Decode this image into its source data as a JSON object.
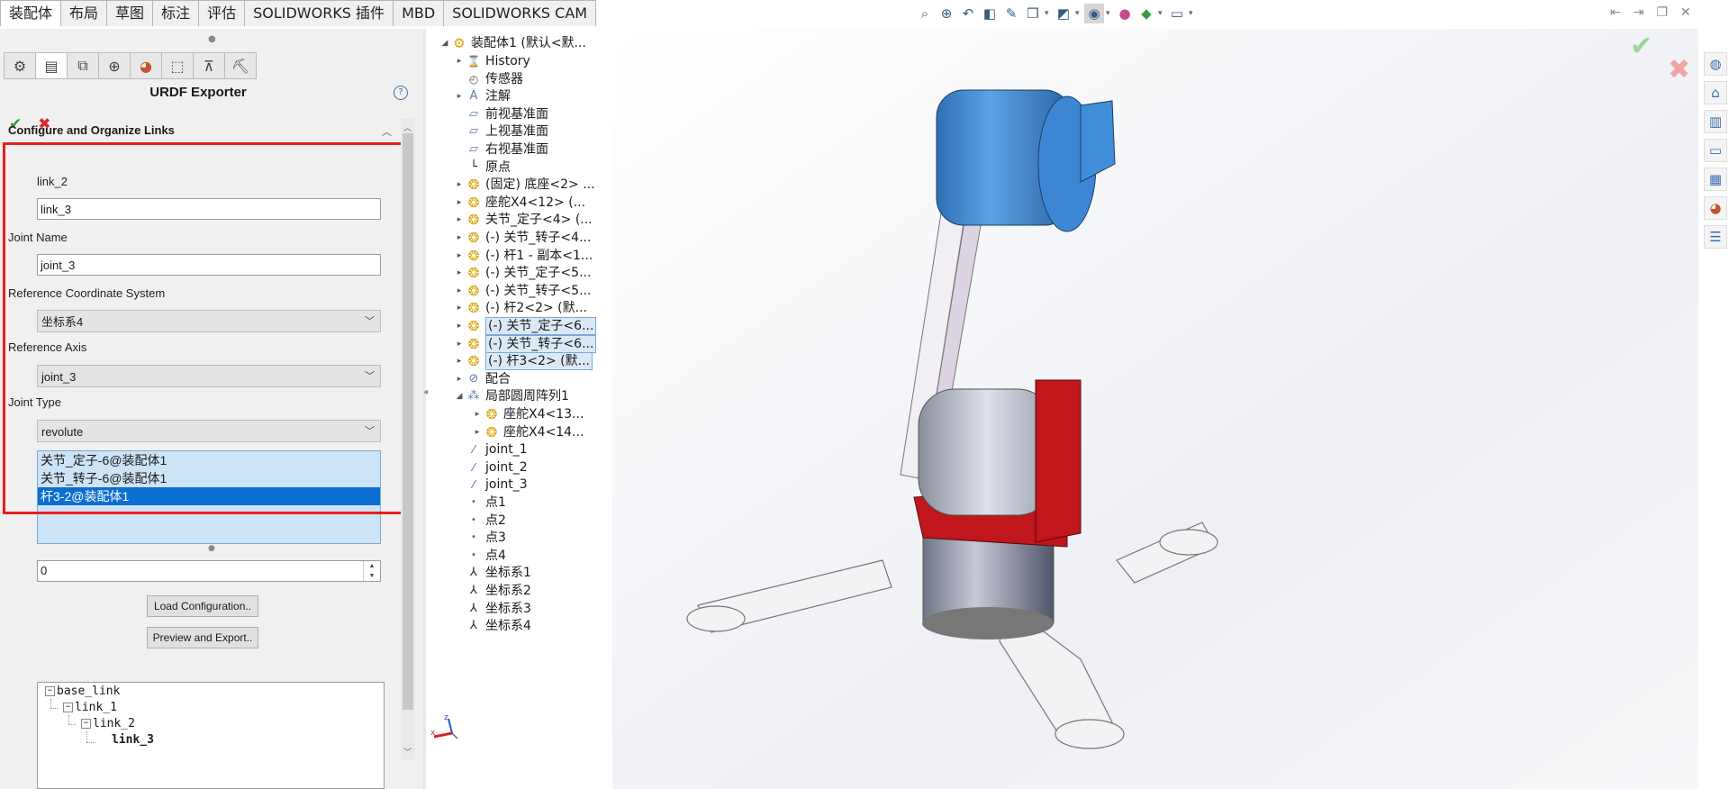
{
  "ribbon": {
    "tabs": [
      "装配体",
      "布局",
      "草图",
      "标注",
      "评估",
      "SOLIDWORKS 插件",
      "MBD",
      "SOLIDWORKS CAM"
    ],
    "active_tab": "装配体",
    "view_icons": [
      "zoom-to-fit-icon",
      "zoom-area-icon",
      "previous-view-icon",
      "section-view-icon",
      "dynamic-annotation-icon",
      "view-orientation-icon",
      "display-style-icon",
      "hide-show-icon",
      "edit-appearance-icon",
      "apply-scene-icon",
      "view-settings-icon"
    ]
  },
  "property_manager": {
    "title": "URDF Exporter",
    "help": "?",
    "ok_glyph": "✔",
    "cancel_glyph": "✖",
    "group_title": "Configure and Organize Links",
    "parent_link": "link_2",
    "link_name_value": "link_3",
    "joint_name_label": "Joint Name",
    "joint_name_value": "joint_3",
    "ref_coord_label": "Reference Coordinate System",
    "ref_coord_value": "坐标系4",
    "ref_axis_label": "Reference Axis",
    "ref_axis_value": "joint_3",
    "joint_type_label": "Joint Type",
    "joint_type_value": "revolute",
    "components": [
      "关节_定子-6@装配体1",
      "关节_转子-6@装配体1",
      "杆3-2@装配体1"
    ],
    "selected_component_index": 2,
    "number_value": "0",
    "load_button": "Load Configuration..",
    "preview_button": "Preview and Export..",
    "tree": {
      "root": "base_link",
      "l1": "link_1",
      "l2": "link_2",
      "l3": "link_3"
    }
  },
  "feature_tree": {
    "root": "装配体1  (默认<默...",
    "items": [
      {
        "label": "History",
        "icon": "history-icon"
      },
      {
        "label": "传感器",
        "icon": "sensor-icon"
      },
      {
        "label": "注解",
        "icon": "annotation-icon"
      },
      {
        "label": "前视基准面",
        "icon": "plane-icon"
      },
      {
        "label": "上视基准面",
        "icon": "plane-icon"
      },
      {
        "label": "右视基准面",
        "icon": "plane-icon"
      },
      {
        "label": "原点",
        "icon": "origin-icon"
      },
      {
        "label": "(固定) 底座<2> ...",
        "icon": "component-icon"
      },
      {
        "label": "座舵X4<12> (...",
        "icon": "component-icon"
      },
      {
        "label": "关节_定子<4> (...",
        "icon": "component-icon"
      },
      {
        "label": "(-) 关节_转子<4...",
        "icon": "component-icon"
      },
      {
        "label": "(-) 杆1 - 副本<1...",
        "icon": "component-icon"
      },
      {
        "label": "(-) 关节_定子<5...",
        "icon": "component-icon"
      },
      {
        "label": "(-) 关节_转子<5...",
        "icon": "component-icon"
      },
      {
        "label": "(-) 杆2<2> (默...",
        "icon": "component-icon"
      },
      {
        "label": "(-) 关节_定子<6...",
        "icon": "component-icon"
      },
      {
        "label": "(-) 关节_转子<6...",
        "icon": "component-icon"
      },
      {
        "label": "(-) 杆3<2> (默...",
        "icon": "component-icon"
      },
      {
        "label": "配合",
        "icon": "mates-icon"
      },
      {
        "label": "局部圆周阵列1",
        "icon": "pattern-icon"
      },
      {
        "label": "座舵X4<13...",
        "icon": "component-icon"
      },
      {
        "label": "座舵X4<14...",
        "icon": "component-icon"
      },
      {
        "label": "joint_1",
        "icon": "axis-icon"
      },
      {
        "label": "joint_2",
        "icon": "axis-icon"
      },
      {
        "label": "joint_3",
        "icon": "axis-icon"
      },
      {
        "label": "点1",
        "icon": "point-icon"
      },
      {
        "label": "点2",
        "icon": "point-icon"
      },
      {
        "label": "点3",
        "icon": "point-icon"
      },
      {
        "label": "点4",
        "icon": "point-icon"
      },
      {
        "label": "坐标系1",
        "icon": "coordinate-system-icon"
      },
      {
        "label": "坐标系2",
        "icon": "coordinate-system-icon"
      },
      {
        "label": "坐标系3",
        "icon": "coordinate-system-icon"
      },
      {
        "label": "坐标系4",
        "icon": "coordinate-system-icon"
      }
    ]
  },
  "triad": {
    "x": "x",
    "z": "z"
  },
  "task_pane_icons": [
    "solidworks-resources-icon",
    "home-icon",
    "design-library-icon",
    "file-explorer-icon",
    "view-palette-icon",
    "appearances-icon",
    "custom-properties-icon"
  ],
  "colors": {
    "accent_red": "#e81f1f",
    "selection_blue": "#0a6fd1",
    "selection_bg": "#cde4f7",
    "model_blue": "#3f8fd8",
    "model_red": "#c0161c"
  }
}
